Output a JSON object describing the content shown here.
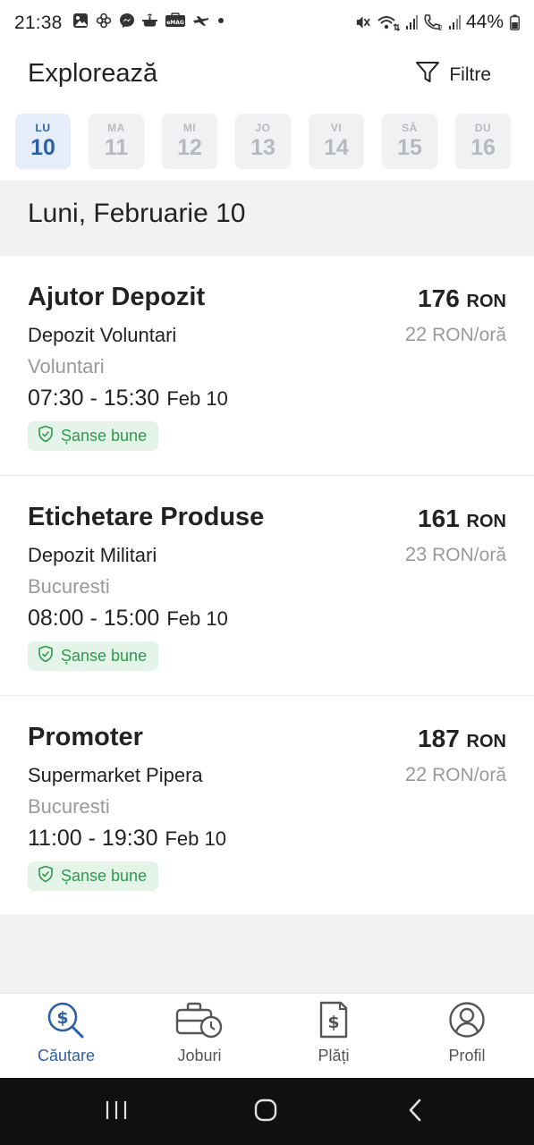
{
  "status_bar": {
    "time": "21:38",
    "battery": "44%",
    "left_icons": [
      "gallery-icon",
      "pinwheel-icon",
      "messenger-icon",
      "cooking-pot-icon",
      "emag-icon",
      "plane-icon",
      "dot-icon"
    ],
    "right_icons": [
      "mute-icon",
      "wifi-icon",
      "signal-icon",
      "call-signal-icon",
      "signal-icon",
      "battery-icon"
    ]
  },
  "header": {
    "title": "Explorează",
    "filter_label": "Filtre",
    "filter_icon": "funnel-icon"
  },
  "days": [
    {
      "name": "LU",
      "num": "10",
      "active": true
    },
    {
      "name": "MA",
      "num": "11",
      "active": false
    },
    {
      "name": "MI",
      "num": "12",
      "active": false
    },
    {
      "name": "JO",
      "num": "13",
      "active": false
    },
    {
      "name": "VI",
      "num": "14",
      "active": false
    },
    {
      "name": "SÂ",
      "num": "15",
      "active": false
    },
    {
      "name": "DU",
      "num": "16",
      "active": false
    }
  ],
  "date_heading": "Luni, Februarie 10",
  "jobs": [
    {
      "title": "Ajutor Depozit",
      "site": "Depozit Voluntari",
      "city": "Voluntari",
      "time": "07:30 - 15:30",
      "date": "Feb 10",
      "badge": "Șanse bune",
      "total": "176",
      "currency": "RON",
      "rate_num": "22",
      "rate_unit": "RON/oră"
    },
    {
      "title": "Etichetare Produse",
      "site": "Depozit Militari",
      "city": "Bucuresti",
      "time": "08:00 - 15:00",
      "date": "Feb 10",
      "badge": "Șanse bune",
      "total": "161",
      "currency": "RON",
      "rate_num": "23",
      "rate_unit": "RON/oră"
    },
    {
      "title": "Promoter",
      "site": "Supermarket Pipera",
      "city": "Bucuresti",
      "time": "11:00 - 19:30",
      "date": "Feb 10",
      "badge": "Șanse bune",
      "total": "187",
      "currency": "RON",
      "rate_num": "22",
      "rate_unit": "RON/oră"
    }
  ],
  "nav": [
    {
      "label": "Căutare",
      "icon": "search-dollar-icon",
      "active": true
    },
    {
      "label": "Joburi",
      "icon": "briefcase-clock-icon",
      "active": false
    },
    {
      "label": "Plăți",
      "icon": "receipt-dollar-icon",
      "active": false
    },
    {
      "label": "Profil",
      "icon": "user-circle-icon",
      "active": false
    }
  ],
  "colors": {
    "accent": "#2c5fa6",
    "day_active_bg": "#e5eefa",
    "day_inactive_bg": "#f0f1f3",
    "badge_bg": "#e4f4e8",
    "badge_text": "#2e9a4e",
    "muted_text": "#9a9a9a"
  }
}
